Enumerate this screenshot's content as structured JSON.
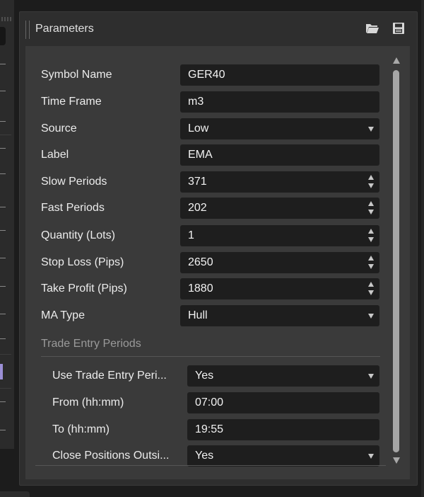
{
  "panel": {
    "title": "Parameters"
  },
  "header_icons": [
    "folder-open-icon",
    "save-icon"
  ],
  "parameters": [
    {
      "label": "Symbol Name",
      "value": "GER40",
      "type": "text"
    },
    {
      "label": "Time Frame",
      "value": "m3",
      "type": "text"
    },
    {
      "label": "Source",
      "value": "Low",
      "type": "dropdown"
    },
    {
      "label": "Label",
      "value": "EMA",
      "type": "text"
    },
    {
      "label": "Slow Periods",
      "value": "371",
      "type": "spinner"
    },
    {
      "label": "Fast Periods",
      "value": "202",
      "type": "spinner"
    },
    {
      "label": "Quantity (Lots)",
      "value": "1",
      "type": "spinner"
    },
    {
      "label": "Stop Loss (Pips)",
      "value": "2650",
      "type": "spinner"
    },
    {
      "label": "Take Profit (Pips)",
      "value": "1880",
      "type": "spinner"
    },
    {
      "label": "MA Type",
      "value": "Hull",
      "type": "dropdown"
    }
  ],
  "group": {
    "title": "Trade Entry Periods",
    "items": [
      {
        "label": "Use Trade Entry Peri...",
        "value": "Yes",
        "type": "dropdown"
      },
      {
        "label": "From (hh:mm)",
        "value": "07:00",
        "type": "text"
      },
      {
        "label": "To (hh:mm)",
        "value": "19:55",
        "type": "text"
      },
      {
        "label": "Close Positions Outsi...",
        "value": "Yes",
        "type": "dropdown"
      }
    ]
  },
  "colors": {
    "background": "#1c1c1c",
    "panel": "#2e2e2e",
    "content": "#3a3a3a",
    "field": "#1e1e1e",
    "accent": "#9b8fd6"
  }
}
